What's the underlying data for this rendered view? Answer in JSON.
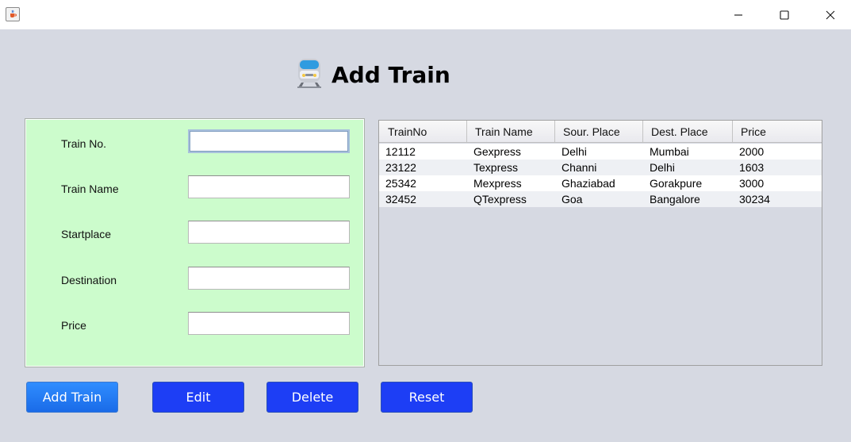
{
  "window": {
    "icon": "java-cup-icon",
    "controls": [
      "minimize-icon",
      "maximize-icon",
      "close-icon"
    ]
  },
  "heading": {
    "icon": "train-icon",
    "title": "Add Train"
  },
  "form": {
    "fields": [
      {
        "label": "Train No.",
        "value": "",
        "focused": true
      },
      {
        "label": "Train Name",
        "value": ""
      },
      {
        "label": "Startplace",
        "value": ""
      },
      {
        "label": "Destination",
        "value": ""
      },
      {
        "label": "Price",
        "value": ""
      }
    ]
  },
  "table": {
    "columns": [
      "TrainNo",
      "Train Name",
      "Sour. Place",
      "Dest. Place",
      "Price"
    ],
    "rows": [
      [
        "12112",
        "Gexpress",
        "Delhi",
        "Mumbai",
        "2000"
      ],
      [
        "23122",
        "Texpress",
        "Channi",
        "Delhi",
        "1603"
      ],
      [
        "25342",
        "Mexpress",
        "Ghaziabad",
        "Gorakpure",
        "3000"
      ],
      [
        "32452",
        "QTexpress",
        "Goa",
        "Bangalore",
        "30234"
      ]
    ]
  },
  "buttons": {
    "add": "Add Train",
    "edit": "Edit",
    "delete": "Delete",
    "reset": "Reset"
  },
  "colors": {
    "window_bg": "#d6d9e2",
    "form_bg": "#ccfccc",
    "button_blue": "#1d3ef5",
    "add_button_blue": "#2f8dff"
  }
}
